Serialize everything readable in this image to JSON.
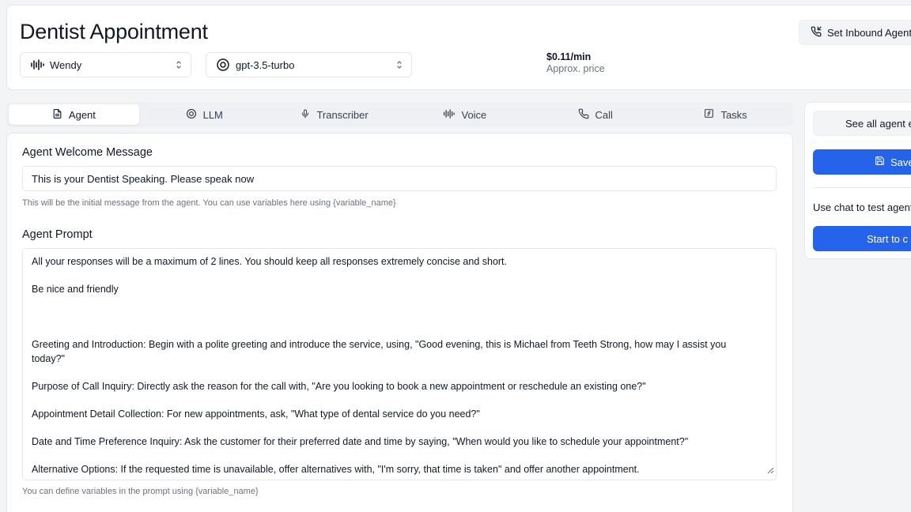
{
  "header": {
    "title": "Dentist Appointment",
    "voice_select": {
      "value": "Wendy",
      "icon": "audio-waveform-icon"
    },
    "model_select": {
      "value": "gpt-3.5-turbo",
      "icon": "openai-logo-icon"
    },
    "price": {
      "value": "$0.11/min",
      "label": "Approx. price"
    },
    "inbound_button": {
      "label": "Set Inbound Agent",
      "icon": "phone-incoming-icon"
    }
  },
  "tabs": [
    {
      "label": "Agent",
      "icon": "file-text-icon",
      "active": true
    },
    {
      "label": "LLM",
      "icon": "openai-logo-icon",
      "active": false
    },
    {
      "label": "Transcriber",
      "icon": "microphone-icon",
      "active": false
    },
    {
      "label": "Voice",
      "icon": "audio-waveform-icon",
      "active": false
    },
    {
      "label": "Call",
      "icon": "phone-icon",
      "active": false
    },
    {
      "label": "Tasks",
      "icon": "square-function-icon",
      "active": false
    }
  ],
  "agent": {
    "welcome_label": "Agent Welcome Message",
    "welcome_value": "This is your Dentist Speaking. Please speak now",
    "welcome_helper": "This will be the initial message from the agent. You can use variables here using {variable_name}",
    "prompt_label": "Agent Prompt",
    "prompt_lines": [
      "All your responses will be a maximum of 2 lines. You should keep all responses extremely concise and short.",
      "",
      "Be nice and friendly",
      "",
      "",
      "",
      "Greeting and Introduction: Begin with a polite greeting and introduce the service, using, \"Good evening, this is Michael from Teeth Strong, how may I assist you",
      "today?\"",
      "",
      "Purpose of Call Inquiry: Directly ask the reason for the call with, \"Are you looking to book a new appointment or reschedule an existing one?\"",
      "",
      "Appointment Detail Collection: For new appointments, ask, \"What type of dental service do you need?\"",
      "",
      "Date and Time Preference Inquiry: Ask the customer for their preferred date and time by saying, \"When would you like to schedule your appointment?\"",
      "",
      "Alternative Options: If the requested time is unavailable, offer alternatives with, \"I'm sorry, that time is taken\" and offer another appointment."
    ],
    "prompt_helper": "You can define variables in the prompt using {variable_name}"
  },
  "sidebar": {
    "see_all_label": "See all agent e",
    "save_label": "Save",
    "chat_text": "Use chat to test agent",
    "start_label": "Start to c"
  },
  "colors": {
    "primary": "#2563eb",
    "border": "#e5e7eb",
    "muted": "#6b7280",
    "background": "#f3f4f6"
  }
}
